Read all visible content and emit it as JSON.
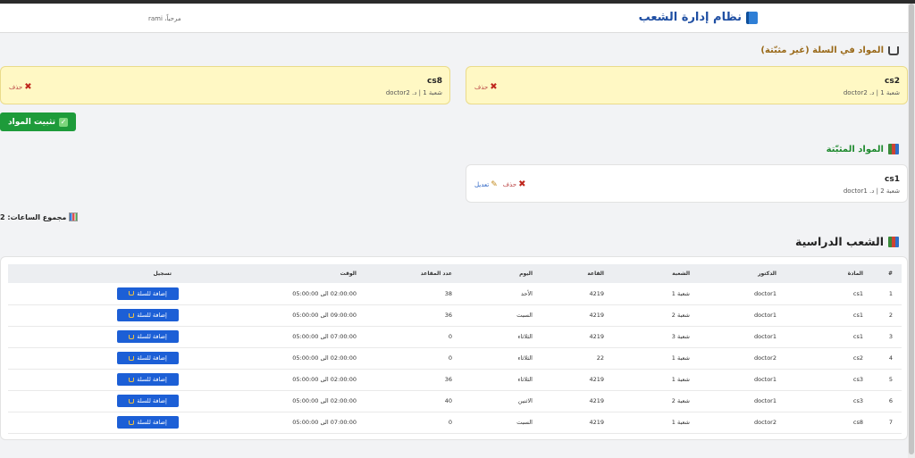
{
  "header": {
    "title": "نظام إدارة الشعب",
    "welcome": "مرحباً، rami"
  },
  "cart": {
    "title": "المواد في السلة (غير مثبّتة)",
    "items": [
      {
        "name": "cs2",
        "meta": "شعبة 1 | د. doctor2",
        "delete_label": "حذف"
      },
      {
        "name": "cs8",
        "meta": "شعبة 1 | د. doctor2",
        "delete_label": "حذف"
      }
    ],
    "confirm_label": "تثبيت المواد"
  },
  "fixed": {
    "title": "المواد المثبّتة",
    "items": [
      {
        "name": "cs1",
        "meta": "شعبة 2 | د. doctor1",
        "edit_label": "تعديل",
        "delete_label": "حذف"
      }
    ],
    "total_hours": "مجموع الساعات: 2"
  },
  "sections": {
    "title": "الشعب الدراسية",
    "columns": [
      "#",
      "المادة",
      "الدكتور",
      "الشعبة",
      "القاعة",
      "اليوم",
      "عدد المقاعد",
      "الوقت",
      "تسجيل"
    ],
    "rows": [
      [
        "1",
        "cs1",
        "doctor1",
        "شعبة 1",
        "4219",
        "الأحد",
        "38",
        "02:00:00 الى 05:00:00"
      ],
      [
        "2",
        "cs1",
        "doctor1",
        "شعبة 2",
        "4219",
        "السبت",
        "36",
        "09:00:00 الى 05:00:00"
      ],
      [
        "3",
        "cs1",
        "doctor1",
        "شعبة 3",
        "4219",
        "الثلاثاء",
        "0",
        "07:00:00 الى 05:00:00"
      ],
      [
        "4",
        "cs2",
        "doctor2",
        "شعبة 1",
        "22",
        "الثلاثاء",
        "0",
        "02:00:00 الى 05:00:00"
      ],
      [
        "5",
        "cs3",
        "doctor1",
        "شعبة 1",
        "4219",
        "الثلاثاء",
        "36",
        "02:00:00 الى 05:00:00"
      ],
      [
        "6",
        "cs3",
        "doctor1",
        "شعبة 2",
        "4219",
        "الاثنين",
        "40",
        "02:00:00 الى 05:00:00"
      ],
      [
        "7",
        "cs8",
        "doctor2",
        "شعبة 1",
        "4219",
        "السبت",
        "0",
        "07:00:00 الى 05:00:00"
      ]
    ],
    "add_label": "إضافة للسلة"
  }
}
